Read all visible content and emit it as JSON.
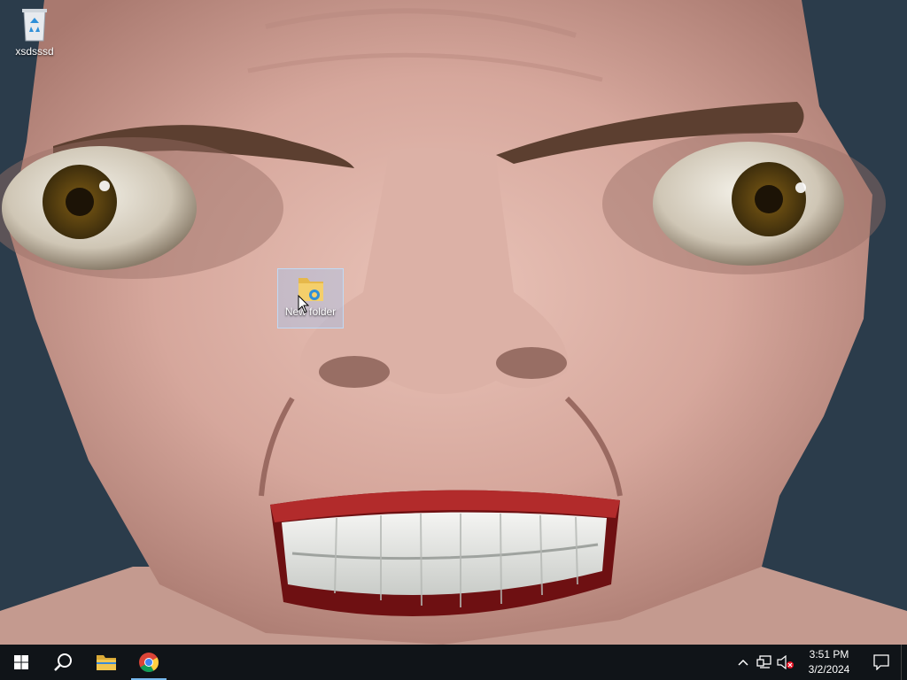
{
  "desktop": {
    "icons": [
      {
        "label": "xsdsssd",
        "icon": "recycle-bin-icon"
      },
      {
        "label": "New folder",
        "icon": "folder-icon"
      }
    ]
  },
  "taskbar": {
    "items": [
      {
        "name": "start",
        "icon": "windows-logo-icon"
      },
      {
        "name": "search",
        "icon": "search-icon"
      },
      {
        "name": "file-explorer",
        "icon": "folder-icon"
      },
      {
        "name": "chrome",
        "icon": "chrome-icon",
        "active": true
      }
    ],
    "tray": {
      "icons": [
        "chevron-up-icon",
        "network-icon",
        "volume-muted-icon"
      ],
      "time": "3:51 PM",
      "date": "3/2/2024"
    }
  },
  "colors": {
    "taskbar_bg": "#101418",
    "desktop_bg": "#2a3b4a",
    "selection": "#99c9ff",
    "active_indicator": "#76b9ed"
  }
}
